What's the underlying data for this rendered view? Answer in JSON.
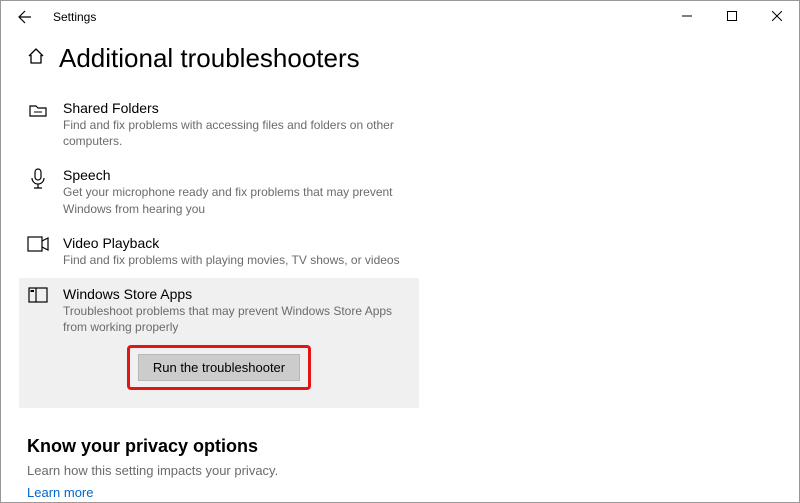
{
  "titlebar": {
    "title": "Settings"
  },
  "page": {
    "heading": "Additional troubleshooters"
  },
  "troubleshooters": [
    {
      "title": "Shared Folders",
      "description": "Find and fix problems with accessing files and folders on other computers."
    },
    {
      "title": "Speech",
      "description": "Get your microphone ready and fix problems that may prevent Windows from hearing you"
    },
    {
      "title": "Video Playback",
      "description": "Find and fix problems with playing movies, TV shows, or videos"
    },
    {
      "title": "Windows Store Apps",
      "description": "Troubleshoot problems that may prevent Windows Store Apps from working properly"
    }
  ],
  "run_button_label": "Run the troubleshooter",
  "privacy": {
    "heading": "Know your privacy options",
    "description": "Learn how this setting impacts your privacy.",
    "link": "Learn more"
  }
}
